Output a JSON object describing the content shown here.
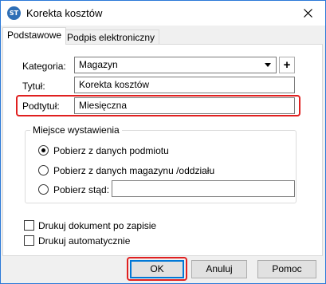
{
  "window": {
    "title": "Korekta kosztów",
    "app_icon_text": "ST"
  },
  "tabs": [
    {
      "label": "Podstawowe",
      "active": true
    },
    {
      "label": "Podpis elektroniczny",
      "active": false
    }
  ],
  "form": {
    "kategoria_label": "Kategoria:",
    "kategoria_value": "Magazyn",
    "add_button": "+",
    "tytul_label": "Tytuł:",
    "tytul_value": "Korekta kosztów",
    "podtytul_label": "Podtytuł:",
    "podtytul_value": "Miesięczna"
  },
  "group": {
    "title": "Miejsce wystawienia",
    "options": [
      {
        "label": "Pobierz z danych podmiotu",
        "checked": true
      },
      {
        "label": "Pobierz z danych magazynu /oddziału",
        "checked": false
      },
      {
        "label": "Pobierz stąd:",
        "checked": false
      }
    ],
    "custom_value": ""
  },
  "checkboxes": [
    {
      "label": "Drukuj dokument po zapisie",
      "checked": false
    },
    {
      "label": "Drukuj automatycznie",
      "checked": false
    }
  ],
  "buttons": {
    "ok": "OK",
    "cancel": "Anuluj",
    "help": "Pomoc"
  },
  "colors": {
    "highlight": "#e02020",
    "focus": "#0078d7",
    "window_border": "#2b79d8"
  }
}
